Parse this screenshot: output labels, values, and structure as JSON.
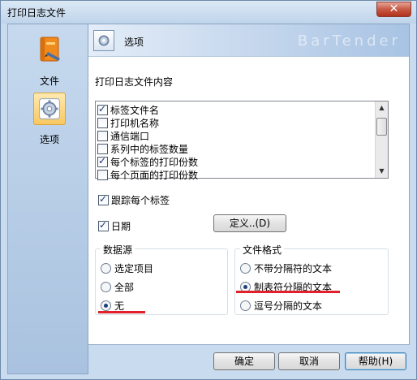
{
  "window": {
    "title": "打印日志文件",
    "close_glyph": "✕"
  },
  "nav": {
    "items": [
      {
        "label": "文件",
        "icon": "file-book-icon"
      },
      {
        "label": "选项",
        "icon": "options-gear-icon",
        "selected": true
      }
    ]
  },
  "header": {
    "title": "选项",
    "icon": "options-gear-icon",
    "watermark": "BarTender"
  },
  "log_content": {
    "label": "打印日志文件内容",
    "items": [
      {
        "label": "标签文件名",
        "checked": true
      },
      {
        "label": "打印机名称",
        "checked": false
      },
      {
        "label": "通信端口",
        "checked": false
      },
      {
        "label": "系列中的标签数量",
        "checked": false
      },
      {
        "label": "每个标签的打印份数",
        "checked": true
      },
      {
        "label": "每个页面的打印份数",
        "checked": false
      }
    ]
  },
  "options": {
    "track_each_label": {
      "label": "跟踪每个标签",
      "checked": true
    },
    "date": {
      "label": "日期",
      "checked": true
    },
    "define_button": "定义..(D)"
  },
  "data_source": {
    "title": "数据源",
    "options": [
      {
        "label": "选定项目",
        "selected": false
      },
      {
        "label": "全部",
        "selected": false
      },
      {
        "label": "无",
        "selected": true
      }
    ]
  },
  "file_format": {
    "title": "文件格式",
    "options": [
      {
        "label": "不带分隔符的文本",
        "selected": false
      },
      {
        "label": "制表符分隔的文本",
        "selected": true
      },
      {
        "label": "逗号分隔的文本",
        "selected": false
      }
    ]
  },
  "footer": {
    "ok": "确定",
    "cancel": "取消",
    "help": "帮助(H)"
  },
  "colors": {
    "annotation": "#e0202a",
    "title_bar": "#c9dbee",
    "nav_bg": "#b4cbe6"
  }
}
